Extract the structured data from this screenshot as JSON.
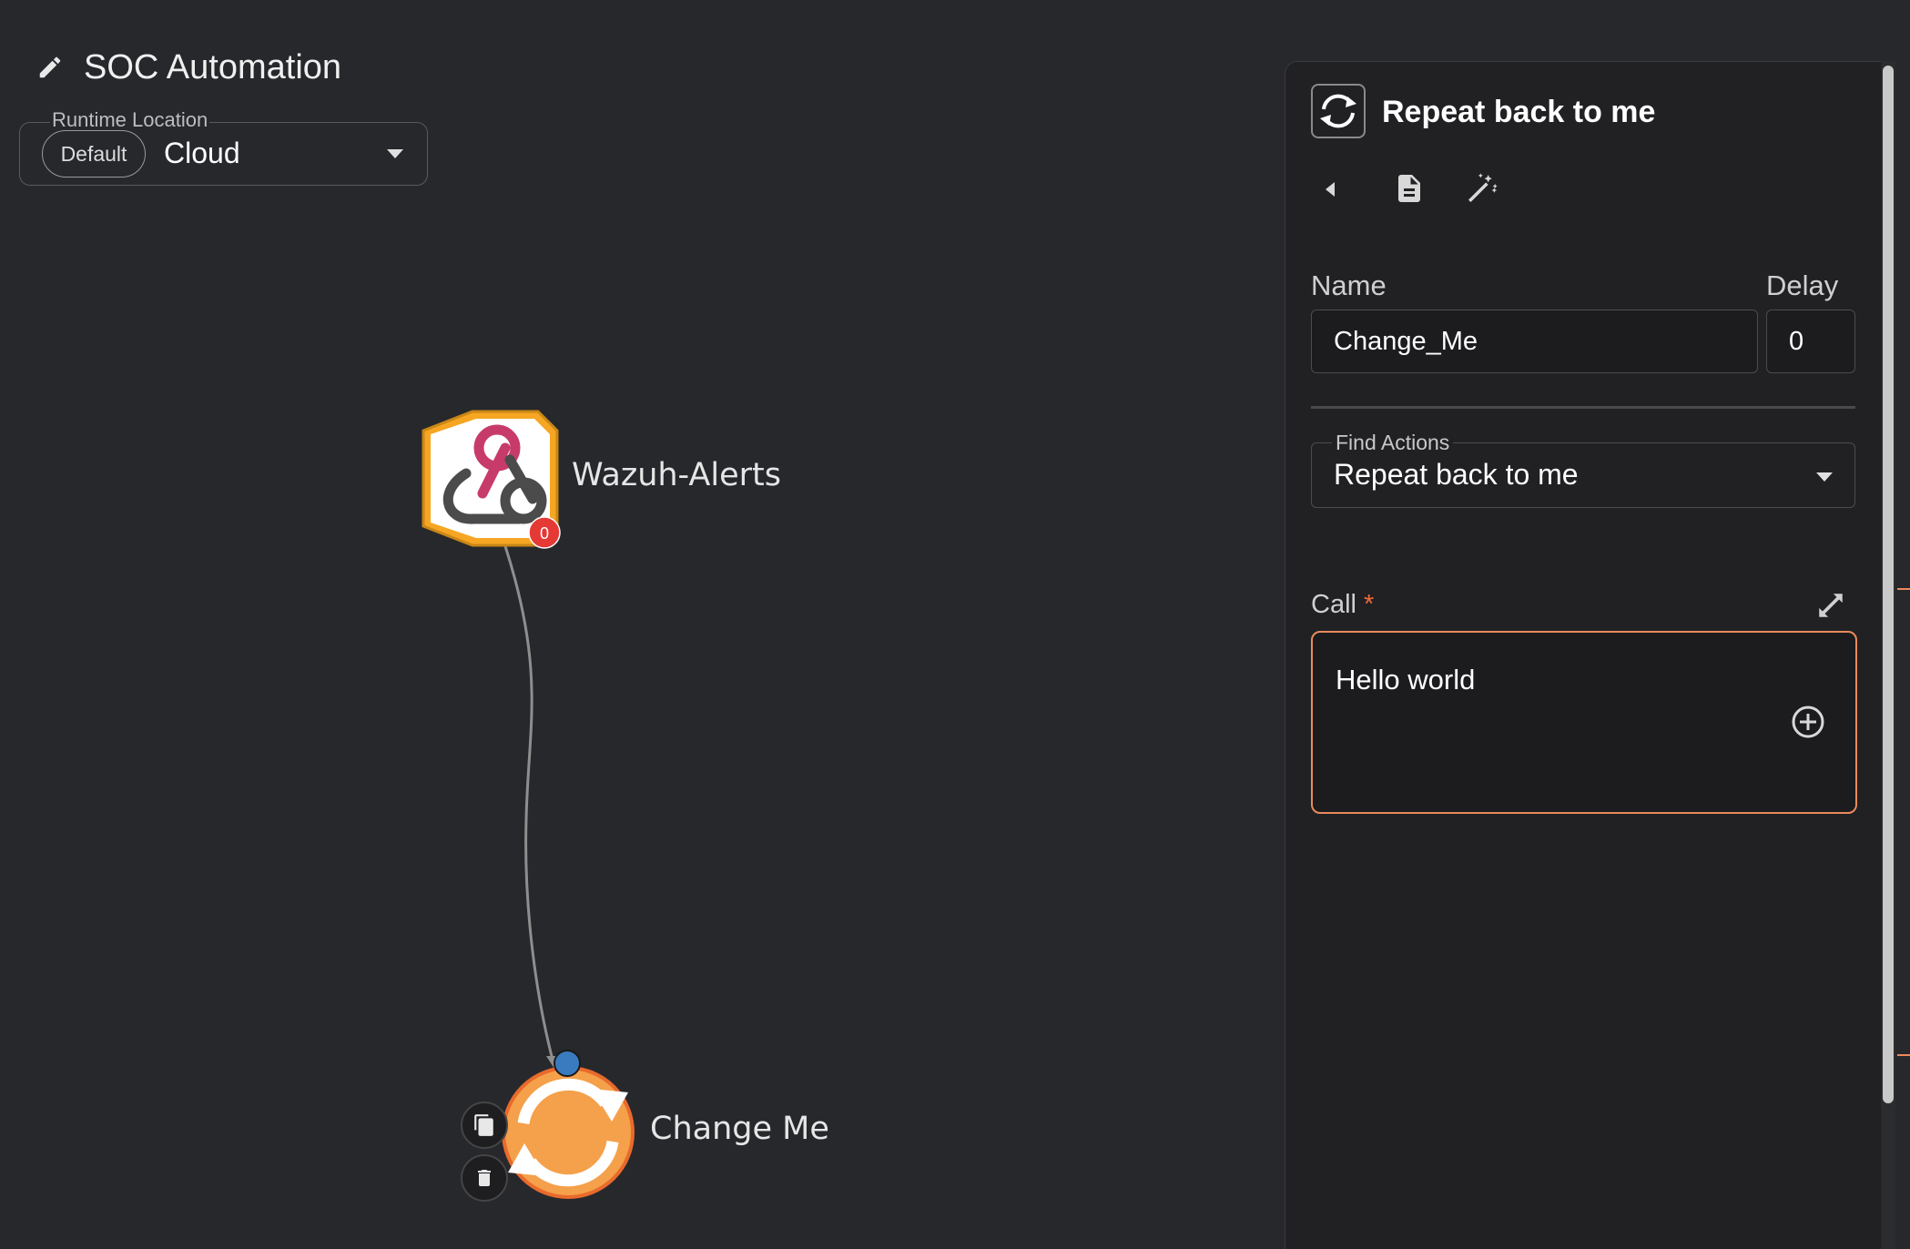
{
  "header": {
    "title": "SOC Automation",
    "edit_icon": "pencil-icon"
  },
  "runtime": {
    "label": "Runtime Location",
    "chip": "Default",
    "value": "Cloud"
  },
  "canvas": {
    "trigger_node": {
      "label": "Wazuh-Alerts",
      "icon": "webhook-icon",
      "badge": "0"
    },
    "action_node": {
      "label": "Change Me",
      "icon": "repeat-icon"
    }
  },
  "panel": {
    "title": "Repeat back to me",
    "app_icon": "repeat-icon",
    "name_label": "Name",
    "name_value": "Change_Me",
    "delay_label": "Delay",
    "delay_value": "0",
    "find_actions_label": "Find Actions",
    "find_actions_value": "Repeat back to me",
    "call_label": "Call",
    "call_required": "*",
    "call_value": "Hello world"
  },
  "colors": {
    "background": "#27282c",
    "panel": "#212124",
    "accent": "#e98a5c",
    "badge": "#e53935",
    "node_orange": "#f08a24",
    "connector_blue": "#3a7bbf"
  }
}
